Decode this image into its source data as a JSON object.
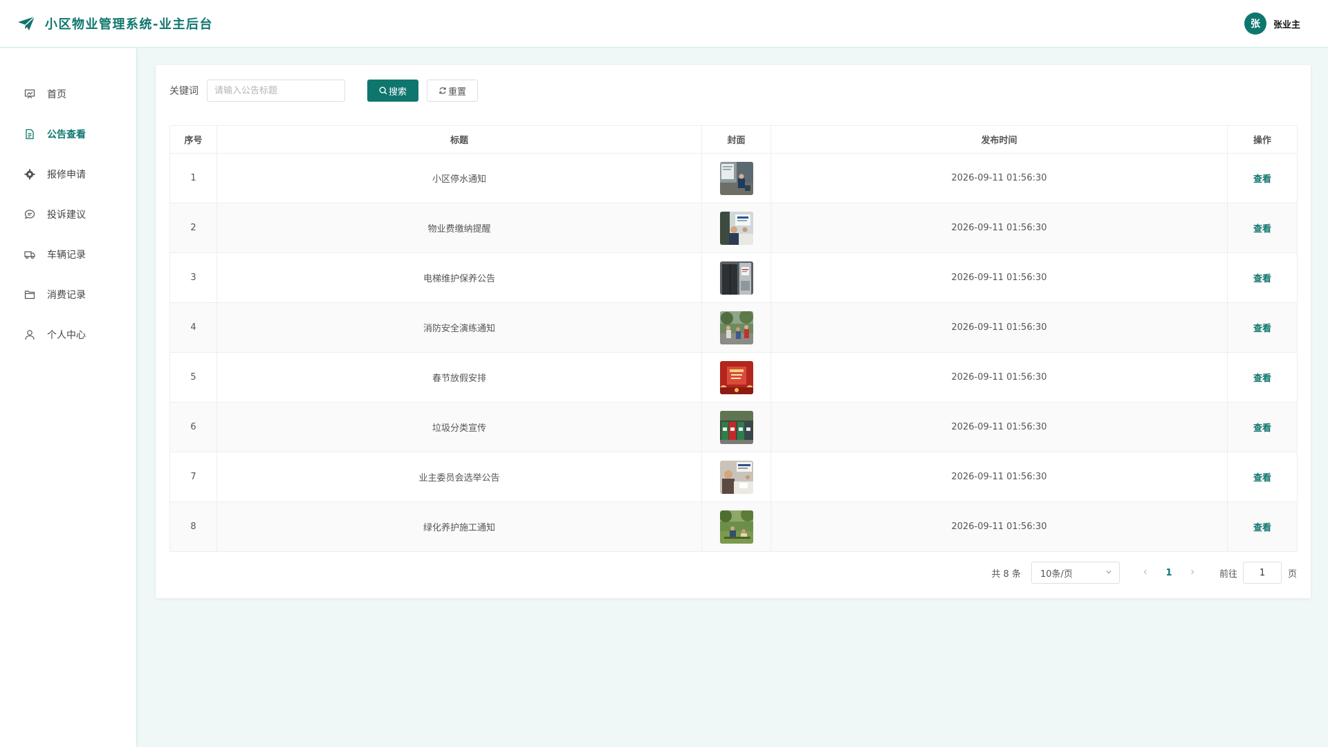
{
  "app": {
    "title": "小区物业管理系统-业主后台",
    "accent_color": "#0f766e"
  },
  "user": {
    "avatar_text": "张",
    "name": "张业主"
  },
  "sidebar": {
    "items": [
      {
        "label": "首页",
        "icon": "presentation-icon"
      },
      {
        "label": "公告查看",
        "icon": "document-icon",
        "active": true
      },
      {
        "label": "报修申请",
        "icon": "gear-icon"
      },
      {
        "label": "投诉建议",
        "icon": "chat-icon"
      },
      {
        "label": "车辆记录",
        "icon": "truck-icon"
      },
      {
        "label": "消费记录",
        "icon": "folder-icon"
      },
      {
        "label": "个人中心",
        "icon": "user-icon"
      }
    ]
  },
  "search": {
    "label": "关键词",
    "placeholder": "请输入公告标题",
    "value": "",
    "search_button": "搜索",
    "reset_button": "重置"
  },
  "table": {
    "headers": [
      "序号",
      "标题",
      "封面",
      "发布时间",
      "操作"
    ],
    "rows": [
      {
        "index": "1",
        "title": "小区停水通知",
        "time": "2026-09-11 01:56:30",
        "action": "查看",
        "cover": "water-notice-photo"
      },
      {
        "index": "2",
        "title": "物业费缴纳提醒",
        "time": "2026-09-11 01:56:30",
        "action": "查看",
        "cover": "fee-office-photo"
      },
      {
        "index": "3",
        "title": "电梯维护保养公告",
        "time": "2026-09-11 01:56:30",
        "action": "查看",
        "cover": "elevator-photo"
      },
      {
        "index": "4",
        "title": "消防安全演练通知",
        "time": "2026-09-11 01:56:30",
        "action": "查看",
        "cover": "fire-drill-photo"
      },
      {
        "index": "5",
        "title": "春节放假安排",
        "time": "2026-09-11 01:56:30",
        "action": "查看",
        "cover": "spring-festival-photo"
      },
      {
        "index": "6",
        "title": "垃圾分类宣传",
        "time": "2026-09-11 01:56:30",
        "action": "查看",
        "cover": "garbage-bins-photo"
      },
      {
        "index": "7",
        "title": "业主委员会选举公告",
        "time": "2026-09-11 01:56:30",
        "action": "查看",
        "cover": "election-photo"
      },
      {
        "index": "8",
        "title": "绿化养护施工通知",
        "time": "2026-09-11 01:56:30",
        "action": "查看",
        "cover": "greening-photo"
      }
    ]
  },
  "pagination": {
    "total": "共 8 条",
    "page_size": "10条/页",
    "current_page": "1",
    "goto_label": "前往",
    "goto_value": "1",
    "page_suffix": "页"
  }
}
